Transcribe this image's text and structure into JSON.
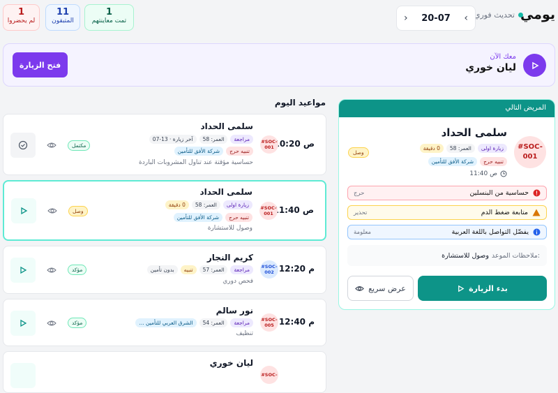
{
  "header": {
    "title": "يومي",
    "refresh_label": "تحديث فوري",
    "date": "20-07",
    "prev_icon": "chevron-left-icon",
    "next_icon": "chevron-right-icon"
  },
  "stats": [
    {
      "value": "1",
      "label": "تمت معاينتهم",
      "color": "#065f46"
    },
    {
      "value": "11",
      "label": "المتبقون",
      "color": "#1e40af"
    },
    {
      "value": "1",
      "label": "لم يحضروا",
      "color": "#b91c1c"
    }
  ],
  "banner": {
    "with_now": "معك الآن",
    "patient": "ليان خوري",
    "open_button": "فتح الزيارة"
  },
  "appointments_title": "مواعيد اليوم",
  "appointments": [
    {
      "time": "10:20 ص",
      "name": "سلمى الحداد",
      "code": "#SOC-001",
      "tags": [
        "مراجعة",
        "العمر: 58",
        "آخر زيارة · 13-07"
      ],
      "tags2": [
        "شركة الأفق للتأمين",
        "تنبيه حرج"
      ],
      "note": "حساسية مؤقتة عند تناول المشروبات الباردة",
      "status": "مكتمل"
    },
    {
      "time": "11:40 ص",
      "name": "سلمى الحداد",
      "code": "#SOC-001",
      "tags": [
        "زيارة اولى",
        "العمر: 58",
        "0 دقيقة"
      ],
      "tags2": [
        "شركة الأفق للتأمين",
        "تنبيه حرج"
      ],
      "note": "وصول للاستشارة",
      "status": "وصل"
    },
    {
      "time": "12:20 م",
      "name": "كريم النجار",
      "code": "#SOC-002",
      "tags": [
        "مراجعة",
        "العمر: 57",
        "تنبيه",
        "بدون تأمين"
      ],
      "note": "فحص دوري",
      "status": "مؤكد"
    },
    {
      "time": "12:40 م",
      "name": "نور سالم",
      "code": "#SOC-005",
      "tags": [
        "مراجعة",
        "العمر: 54",
        "الشرق العربي للتأمين ..."
      ],
      "note": "تنظيف",
      "status": "مؤكد"
    },
    {
      "name": "ليان خوري",
      "code": "#SOC-"
    }
  ],
  "next_patient": {
    "header": "المريض التالي",
    "name": "سلمى الحداد",
    "code": "#SOC-001",
    "tags": [
      "زيارة اولى",
      "العمر: 58",
      "0 دقيقة"
    ],
    "tags2": [
      "شركة الأفق للتأمين",
      "تنبيه حرج"
    ],
    "status": "وصل",
    "time": "11:40 ص",
    "alerts": [
      {
        "text": "حساسية من البنسلين",
        "level": "حرج"
      },
      {
        "text": "متابعة ضغط الدم",
        "level": "تحذير"
      },
      {
        "text": "يفضّل التواصل باللغة العربية",
        "level": "معلومة"
      }
    ],
    "notes_label": "ملاحظات الموعد:",
    "notes_value": "وصول للاستشارة",
    "start_button": "بدء الزيارة",
    "quick_view_button": "عرض سريع"
  }
}
